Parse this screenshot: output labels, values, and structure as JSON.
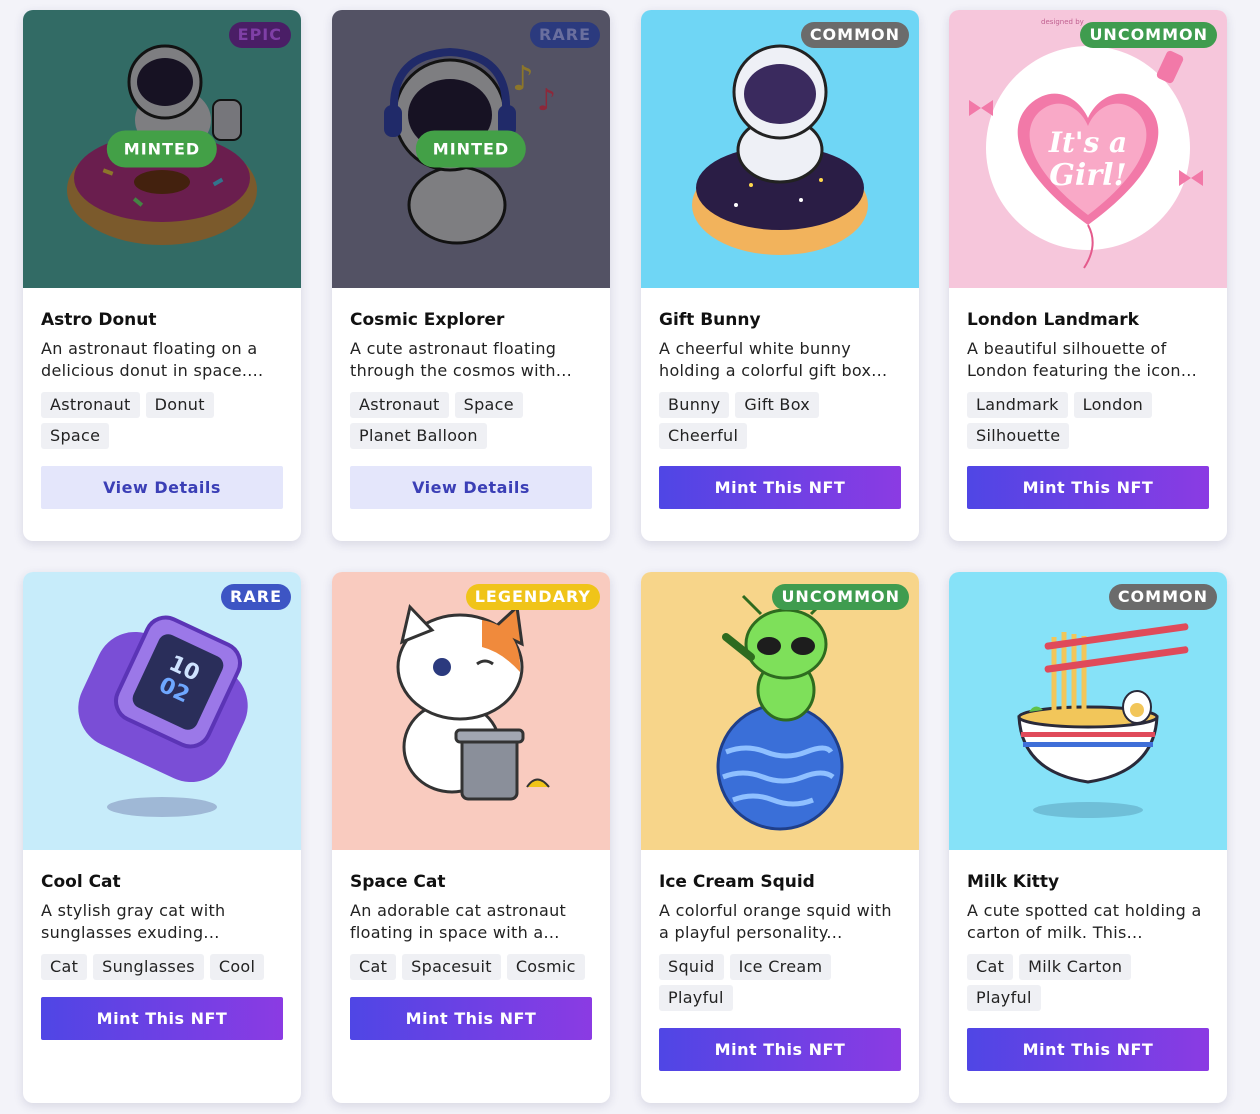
{
  "cards": [
    {
      "title": "Astro Donut",
      "description": "An astronaut floating on a delicious donut in space....",
      "tags": [
        "Astronaut",
        "Donut",
        "Space"
      ],
      "rarity": "EPIC",
      "rarity_color": "#6b2a8f",
      "minted_label": "MINTED",
      "button": "View Details",
      "bg": "#5cc3b8"
    },
    {
      "title": "Cosmic Explorer",
      "description": "A cute astronaut floating through the cosmos with...",
      "tags": [
        "Astronaut",
        "Space",
        "Planet Balloon"
      ],
      "rarity": "RARE",
      "rarity_color": "#3d55c4",
      "minted_label": "MINTED",
      "button": "View Details",
      "bg": "#9796b6"
    },
    {
      "title": "Gift Bunny",
      "description": "A cheerful white bunny holding a colorful gift box...",
      "tags": [
        "Bunny",
        "Gift Box",
        "Cheerful"
      ],
      "rarity": "COMMON",
      "rarity_color": "#6b6b6b",
      "button": "Mint This NFT",
      "bg": "#6fd6f5"
    },
    {
      "title": "London Landmark",
      "description": "A beautiful silhouette of London featuring the icon...",
      "tags": [
        "Landmark",
        "London",
        "Silhouette"
      ],
      "rarity": "UNCOMMON",
      "rarity_color": "#3f9c4f",
      "button": "Mint This NFT",
      "bg": "#f6c6db"
    },
    {
      "title": "Cool Cat",
      "description": "A stylish gray cat with sunglasses exuding...",
      "tags": [
        "Cat",
        "Sunglasses",
        "Cool"
      ],
      "rarity": "RARE",
      "rarity_color": "#3d55c4",
      "button": "Mint This NFT",
      "bg": "#c7ecfa"
    },
    {
      "title": "Space Cat",
      "description": "An adorable cat astronaut floating in space with a...",
      "tags": [
        "Cat",
        "Spacesuit",
        "Cosmic"
      ],
      "rarity": "LEGENDARY",
      "rarity_color": "#f0c419",
      "button": "Mint This NFT",
      "bg": "#f9cbbf"
    },
    {
      "title": "Ice Cream Squid",
      "description": "A colorful orange squid with a playful personality...",
      "tags": [
        "Squid",
        "Ice Cream",
        "Playful"
      ],
      "rarity": "UNCOMMON",
      "rarity_color": "#3f9c4f",
      "button": "Mint This NFT",
      "bg": "#f7d58a"
    },
    {
      "title": "Milk Kitty",
      "description": "A cute spotted cat holding a carton of milk. This...",
      "tags": [
        "Cat",
        "Milk Carton",
        "Playful"
      ],
      "rarity": "COMMON",
      "rarity_color": "#6b6b6b",
      "button": "Mint This NFT",
      "bg": "#86e2f8"
    }
  ],
  "art_text": {
    "heart_line1": "It's a",
    "heart_line2": "Girl!",
    "watch_hour": "10",
    "watch_min": "02",
    "watermark": "designed by"
  }
}
